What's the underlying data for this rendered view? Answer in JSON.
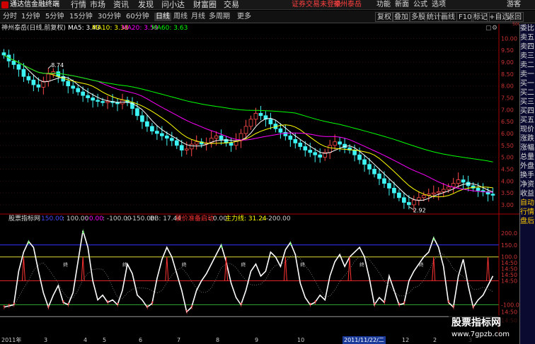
{
  "app": {
    "title": "通达信金融终端",
    "menu": [
      "行情",
      "市场",
      "资讯",
      "发现",
      "问小达",
      "财富圈",
      "交易"
    ],
    "notice": "证券交易未登录",
    "broker": "神州泰岳",
    "right_menu": [
      "功能",
      "新面",
      "公式",
      "选项",
      "游客"
    ]
  },
  "toolbar": {
    "periods": [
      "分时",
      "1分钟",
      "5分钟",
      "15分钟",
      "30分钟",
      "60分钟",
      "日线",
      "周线",
      "月线",
      "多周期",
      "更多"
    ],
    "active_period": "日线",
    "right_tools": [
      "复权",
      "叠加",
      "多股",
      "统计",
      "画线",
      "F10",
      "标记",
      "+自选",
      "返回"
    ]
  },
  "main_chart": {
    "stock_label": "神州泰岳(日线,前复权)",
    "ma_labels": [
      "MA5: 3.43",
      "MA10: 3.38",
      "MA20: 3.59",
      "MA60: 3.63"
    ],
    "ma_colors": [
      "#ffffff",
      "#ffff00",
      "#ff00ff",
      "#00ff00"
    ],
    "y_ticks": [
      "10.00",
      "9.50",
      "9.00",
      "8.50",
      "8.00",
      "7.50",
      "7.00",
      "6.50",
      "6.00",
      "5.50",
      "5.00",
      "4.50",
      "4.00",
      "3.50",
      "3.00"
    ],
    "y_range": [
      2.7,
      10.25
    ],
    "high_label": "8.74",
    "low_label": "2.92",
    "corner_label": "500",
    "closes": [
      9.3,
      9.05,
      8.9,
      8.7,
      8.4,
      8.25,
      8.05,
      7.95,
      8.2,
      8.5,
      8.6,
      8.4,
      8.2,
      8.0,
      7.9,
      7.75,
      7.6,
      7.5,
      7.4,
      7.35,
      7.3,
      7.35,
      7.3,
      7.25,
      7.4,
      7.3,
      7.05,
      6.75,
      6.5,
      6.3,
      6.1,
      6.0,
      5.9,
      5.8,
      5.7,
      5.5,
      5.3,
      5.35,
      5.55,
      5.65,
      5.55,
      5.6,
      5.8,
      5.9,
      5.75,
      5.6,
      5.5,
      5.7,
      6.0,
      6.3,
      6.6,
      6.85,
      6.75,
      6.6,
      6.4,
      6.2,
      6.05,
      5.9,
      5.75,
      5.6,
      5.45,
      5.3,
      5.2,
      5.1,
      5.0,
      5.2,
      5.5,
      5.65,
      5.55,
      5.4,
      5.3,
      5.1,
      4.9,
      4.7,
      4.5,
      4.3,
      4.1,
      3.9,
      3.7,
      3.5,
      3.3,
      3.1,
      3.0,
      3.2,
      3.3,
      3.4,
      3.45,
      3.5,
      3.55,
      3.65,
      3.75,
      3.9,
      4.05,
      3.95,
      3.8,
      3.7,
      3.6,
      3.55,
      3.45,
      3.4
    ]
  },
  "indicator": {
    "name": "股票指标网",
    "header": [
      {
        "text": "150.00",
        "color": "#4a4aff"
      },
      {
        "text": ": 100.00",
        "color": "#cccccc"
      },
      {
        "text": ": 0.00",
        "color": "#ff00ff"
      },
      {
        "text": ": -100.00",
        "color": "#cccccc"
      },
      {
        "text": ": -150.00",
        "color": "#cccccc"
      },
      {
        "text": "BB: 17.44",
        "color": "#cccccc"
      },
      {
        "text": "股价准备启动",
        "color": "#ff3333"
      },
      {
        "text": ": 0.00",
        "color": "#cccccc"
      },
      {
        "text": "主力线: 31.24",
        "color": "#ffff00"
      },
      {
        "text": ": -200.00",
        "color": "#cccccc"
      }
    ],
    "y_ticks": [
      "200.0",
      "150.0",
      "100.0",
      "14:50",
      "14:50",
      "14:50",
      "14:50",
      "-100.0",
      "14:50",
      "14:50"
    ],
    "y_range": [
      -220,
      235
    ],
    "levels": [
      {
        "value": 150,
        "color": "#3333ff"
      },
      {
        "value": 100,
        "color": "#dddd33"
      },
      {
        "value": 0,
        "color": "#dd2222"
      },
      {
        "value": -100,
        "color": "#33aa33"
      },
      {
        "value": -150,
        "color": "#999999"
      }
    ],
    "line_values": [
      -110,
      -105,
      -100,
      40,
      120,
      165,
      140,
      40,
      -50,
      -110,
      -60,
      -20,
      -90,
      -100,
      -50,
      80,
      210,
      140,
      0,
      -80,
      -60,
      -90,
      -80,
      -100,
      -40,
      70,
      30,
      -60,
      -80,
      -110,
      -95,
      10,
      90,
      140,
      100,
      30,
      -40,
      -130,
      -110,
      -40,
      0,
      30,
      70,
      110,
      150,
      80,
      -10,
      -70,
      -100,
      -40,
      40,
      70,
      20,
      40,
      120,
      100,
      60,
      130,
      160,
      110,
      -10,
      -70,
      -100,
      -90,
      -60,
      -80,
      20,
      80,
      110,
      60,
      100,
      120,
      140,
      100,
      10,
      -100,
      -70,
      -90,
      20,
      -40,
      -100,
      -95,
      0,
      40,
      70,
      100,
      120,
      180,
      140,
      60,
      -90,
      -110,
      20,
      90,
      -20,
      -110,
      -80,
      -60,
      -20,
      20
    ],
    "signal_bars": [
      4,
      16,
      33,
      45,
      57,
      70,
      87,
      98
    ],
    "labels": [
      "终",
      "终",
      "终",
      "终",
      "终",
      "终",
      "终"
    ],
    "x_labels": [
      "2011年",
      "3",
      "4",
      "5",
      "6",
      "7",
      "8",
      "9",
      "10",
      "2011/11/22/二",
      "12",
      "2",
      "3"
    ]
  },
  "sidebar": [
    "委比",
    "卖五",
    "卖四",
    "卖三",
    "卖二",
    "卖一",
    "买一",
    "买二",
    "买三",
    "买四",
    "买五",
    "现价",
    "涨跌",
    "涨幅",
    "总量",
    "外盘",
    "换手",
    "净资",
    "收益",
    "自动",
    "行情",
    "盘后"
  ],
  "watermark": {
    "line1": "股票指标网",
    "line2": "www.7gpzb.com"
  }
}
